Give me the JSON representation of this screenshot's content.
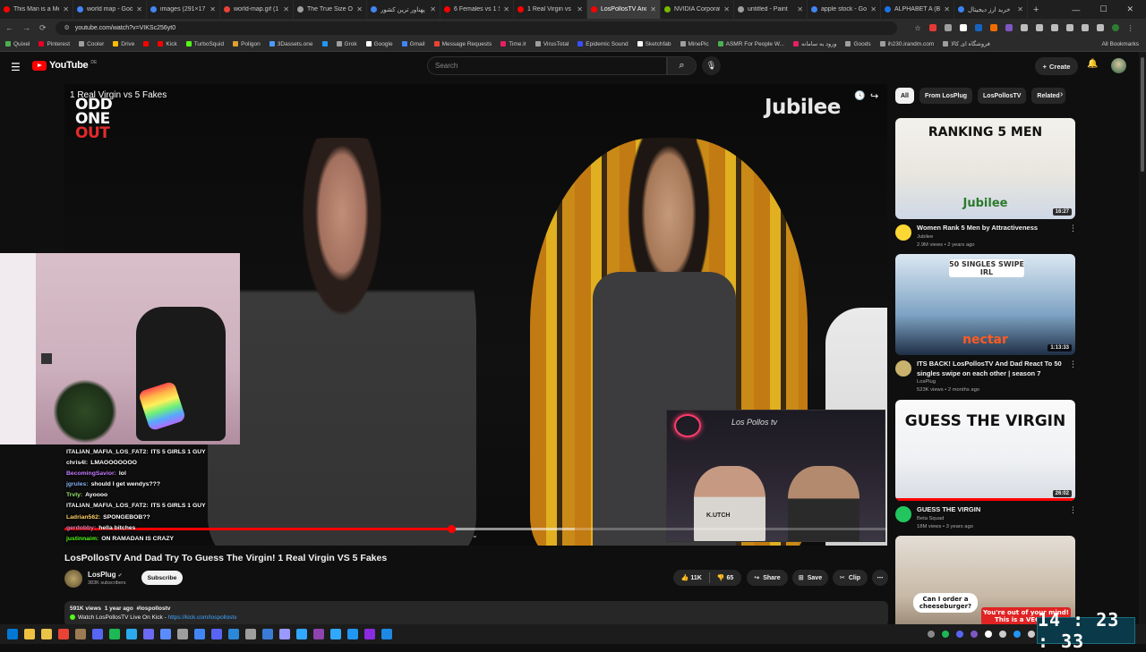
{
  "browser": {
    "tabs": [
      {
        "label": "This Man is a Me",
        "color": "#ff0000"
      },
      {
        "label": "world map - Goo",
        "color": "#4285f4"
      },
      {
        "label": "images (291×17",
        "color": "#4285f4"
      },
      {
        "label": "world-map.gif (1",
        "color": "#ea4335"
      },
      {
        "label": "The True Size Of",
        "color": "#9e9e9e"
      },
      {
        "label": "پهناور ترین کشور",
        "color": "#4285f4"
      },
      {
        "label": "6 Females vs 1 S",
        "color": "#ff0000"
      },
      {
        "label": "1 Real Virgin vs ",
        "color": "#ff0000"
      },
      {
        "label": "LosPollosTV And",
        "color": "#ff0000"
      },
      {
        "label": "NVIDIA Corporat",
        "color": "#76b900"
      },
      {
        "label": "untitled - Paint",
        "color": "#9e9e9e"
      },
      {
        "label": "apple stock - Go",
        "color": "#4285f4"
      },
      {
        "label": "ALPHABET A (B",
        "color": "#1a73e8"
      },
      {
        "label": "خرید ارز دیجیتال",
        "color": "#3b82f6"
      }
    ],
    "active_tab_index": 8,
    "url": "youtube.com/watch?v=VIKSc256yt0",
    "bookmarks": [
      "Quixel",
      "Pinterest",
      "Cooler",
      "Drive",
      "",
      "Kick",
      "TurboSquid",
      "Poligon",
      "3Dassets.one",
      "",
      "Grok",
      "Google",
      "Gmail",
      "Message Requests",
      "Time.lr",
      "VirusTotal",
      "Epidemic Sound",
      "Sketchfab",
      "MinePic",
      "ASMR For People W...",
      "ورود به سامانه",
      "Goods",
      "ih230.irandm.com",
      "فروشگاه ای کالا"
    ],
    "all_bookmarks": "All Bookmarks"
  },
  "youtube": {
    "logo": "YouTube",
    "country": "DE",
    "search_placeholder": "Search",
    "create": "Create"
  },
  "player": {
    "overlay_title": "1 Real Virgin vs 5 Fakes",
    "brand": "Jubilee",
    "show_logo_lines": [
      "ODD",
      "ONE",
      "OUT"
    ],
    "progress": 0.47,
    "buffered": 0.62,
    "chat": [
      {
        "user": "ITALIAN_MAFIA_LOS_FAT2:",
        "msg": "ITS 5 GIRLS 1 GUY",
        "color": "#f5f5f5"
      },
      {
        "user": "chris4l:",
        "msg": "LMAOOOOOOO",
        "color": "#f5f5f5"
      },
      {
        "user": "BecomingSavior:",
        "msg": "lol",
        "color": "#c77dff"
      },
      {
        "user": "jgrules:",
        "msg": "should I get wendys???",
        "color": "#8ab4f8"
      },
      {
        "user": "Trvly:",
        "msg": "Ayoooo",
        "color": "#9ae66e"
      },
      {
        "user": "ITALIAN_MAFIA_LOS_FAT2:",
        "msg": "ITS 5 GIRLS 1 GUY",
        "color": "#f5f5f5"
      },
      {
        "user": "Ladrian562:",
        "msg": "SPONGEBOB??",
        "color": "#ffd166"
      },
      {
        "user": "gerdobby:",
        "msg": "hella bitches",
        "color": "#ff7eb6"
      },
      {
        "user": "justinnaim:",
        "msg": "ON RAMADAN IS CRAZY",
        "color": "#53fc18"
      }
    ],
    "cam_signature": "Los Pollos tv",
    "cam_shirt": "K.UTCH"
  },
  "video": {
    "title": "LosPollosTV And Dad Try To Guess The Virgin! 1 Real Virgin VS 5 Fakes",
    "channel": "LosPlug",
    "subscribers": "383K subscribers",
    "subscribe": "Subscribe",
    "likes": "11K",
    "dislikes": "65",
    "share": "Share",
    "save": "Save",
    "clip": "Clip",
    "views": "591K views",
    "age": "1 year ago",
    "hashtag": "#lospollostv",
    "desc_line": "Watch LosPollosTV Live On Kick - ",
    "desc_link": "https://kick.com/lospollostv"
  },
  "sidebar": {
    "chips": [
      "All",
      "From LosPlug",
      "LosPollosTV",
      "Related"
    ],
    "recs": [
      {
        "title": "Women Rank 5 Men by Attractiveness",
        "channel": "Jubilee",
        "meta": "2.9M views • 2 years ago",
        "duration": "16:27",
        "thumb_text": "RANKING 5 MEN",
        "thumb_sub": "Jubilee"
      },
      {
        "title": "ITS BACK! LosPollosTV And Dad React To 50 singles swipe on each other | season 7",
        "channel": "LosPlug",
        "meta": "523K views • 2 months ago",
        "duration": "1:13:33",
        "thumb_text": "50 SINGLES SWIPE IRL",
        "thumb_sub": "nectar"
      },
      {
        "title": "GUESS THE VIRGIN",
        "channel": "Beta Squad",
        "meta": "18M views • 3 years ago",
        "duration": "26:02",
        "thumb_text": "GUESS THE VIRGIN",
        "thumb_sub": ""
      },
      {
        "title": "",
        "channel": "",
        "meta": "",
        "duration": "",
        "thumb_text": "Can I order a cheeseburger?",
        "thumb_sub": "You're out of your mind! This is a VEGAN..."
      }
    ]
  },
  "taskbar": {
    "clock": "14 : 23 : 33"
  }
}
